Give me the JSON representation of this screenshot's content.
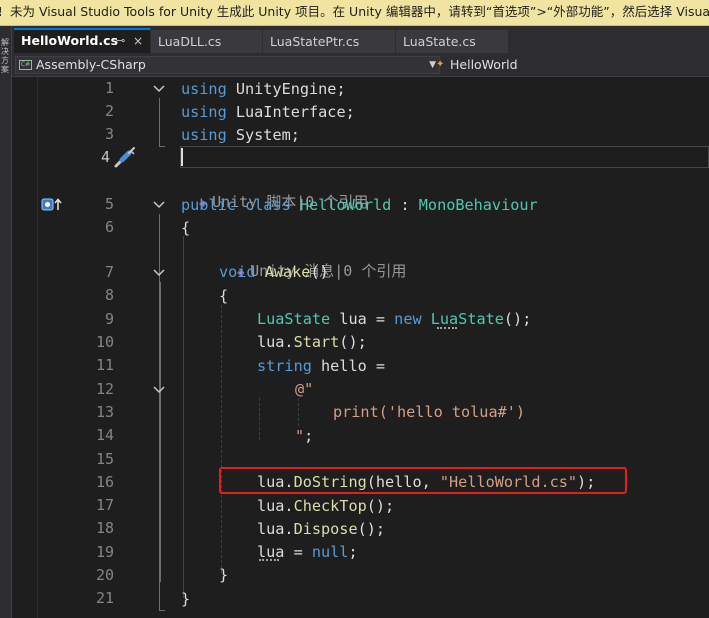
{
  "infobar": {
    "icon": "warning-icon",
    "message": "未为 Visual Studio Tools for Unity 生成此 Unity 项目。在 Unity 编辑器中，请转到“首选项”>“外部功能”，然后选择 Visual Studio"
  },
  "side_toolwindow": {
    "label": "解决方案"
  },
  "tabs": [
    {
      "label": "HelloWorld.cs",
      "active": true,
      "pin": "⊸",
      "close": "×"
    },
    {
      "label": "LuaDLL.cs",
      "active": false
    },
    {
      "label": "LuaStatePtr.cs",
      "active": false
    },
    {
      "label": "LuaState.cs",
      "active": false
    }
  ],
  "navbar": {
    "project_icon": "csharp-project-icon",
    "project_text": "C#",
    "project": "Assembly-CSharp",
    "class_icon": "class-icon",
    "member": "HelloWorld"
  },
  "editor": {
    "current_line": "4",
    "lens_script": "Unity 脚本|0 个引用",
    "lens_message": "Unity 消息|0 个引用",
    "line_numbers": [
      "1",
      "2",
      "3",
      "4",
      "5",
      "6",
      "7",
      "8",
      "9",
      "10",
      "11",
      "12",
      "13",
      "14",
      "15",
      "16",
      "17",
      "18",
      "19",
      "20",
      "21"
    ],
    "lines": [
      {
        "n": 1,
        "tokens": [
          [
            "kw",
            "using"
          ],
          [
            "",
            "UnityEngine;"
          ]
        ]
      },
      {
        "n": 2,
        "tokens": [
          [
            "kw",
            "using"
          ],
          [
            "",
            "LuaInterface;"
          ]
        ]
      },
      {
        "n": 3,
        "tokens": [
          [
            "kw",
            "using"
          ],
          [
            "",
            "System;"
          ]
        ]
      },
      {
        "n": 4,
        "tokens": []
      },
      {
        "n": 5,
        "tokens": [
          [
            "kw",
            "public"
          ],
          [
            "kw",
            "class"
          ],
          [
            "ty",
            "HelloWorld"
          ],
          [
            "",
            ":"
          ],
          [
            "ty",
            "MonoBehaviour"
          ]
        ]
      },
      {
        "n": 6,
        "tokens": [
          [
            "",
            "{"
          ]
        ]
      },
      {
        "n": 7,
        "tokens": [
          [
            "kw",
            "void"
          ],
          [
            "fn",
            "Awake"
          ],
          [
            "",
            "()"
          ]
        ]
      },
      {
        "n": 8,
        "tokens": [
          [
            "",
            "{"
          ]
        ]
      },
      {
        "n": 9,
        "tokens": [
          [
            "ty",
            "LuaState"
          ],
          [
            "",
            "lua ="
          ],
          [
            "kw",
            "new"
          ],
          [
            "ty",
            "LuaState"
          ],
          [
            "",
            "();"
          ]
        ]
      },
      {
        "n": 10,
        "tokens": [
          [
            "",
            "lua."
          ],
          [
            "fn",
            "Start"
          ],
          [
            "",
            "();"
          ]
        ]
      },
      {
        "n": 11,
        "tokens": [
          [
            "kw",
            "string"
          ],
          [
            "",
            "hello ="
          ]
        ]
      },
      {
        "n": 12,
        "tokens": [
          [
            "str",
            "@\""
          ]
        ]
      },
      {
        "n": 13,
        "tokens": [
          [
            "str",
            "print('hello tolua#')"
          ]
        ]
      },
      {
        "n": 14,
        "tokens": [
          [
            "str",
            "\""
          ],
          [
            "",
            ";"
          ]
        ]
      },
      {
        "n": 15,
        "tokens": []
      },
      {
        "n": 16,
        "tokens": [
          [
            "",
            "lua."
          ],
          [
            "fn",
            "DoString"
          ],
          [
            "",
            "(hello,"
          ],
          [
            "str",
            "\"HelloWorld.cs\""
          ],
          [
            "",
            ");"
          ]
        ]
      },
      {
        "n": 17,
        "tokens": [
          [
            "",
            "lua."
          ],
          [
            "fn",
            "CheckTop"
          ],
          [
            "",
            "();"
          ]
        ]
      },
      {
        "n": 18,
        "tokens": [
          [
            "",
            "lua."
          ],
          [
            "fn",
            "Dispose"
          ],
          [
            "",
            "();"
          ]
        ]
      },
      {
        "n": 19,
        "tokens": [
          [
            "",
            "lua ="
          ],
          [
            "kw",
            "null"
          ],
          [
            "",
            ";"
          ]
        ]
      },
      {
        "n": 20,
        "tokens": [
          [
            "",
            "}"
          ]
        ]
      },
      {
        "n": 21,
        "tokens": [
          [
            "",
            "}"
          ]
        ]
      }
    ]
  },
  "colors": {
    "keyword": "#569cd6",
    "type": "#4ec9b0",
    "method": "#dcdcaa",
    "string": "#d69d85",
    "highlight_box": "#e0201c",
    "tab_accent": "#0078d4"
  }
}
